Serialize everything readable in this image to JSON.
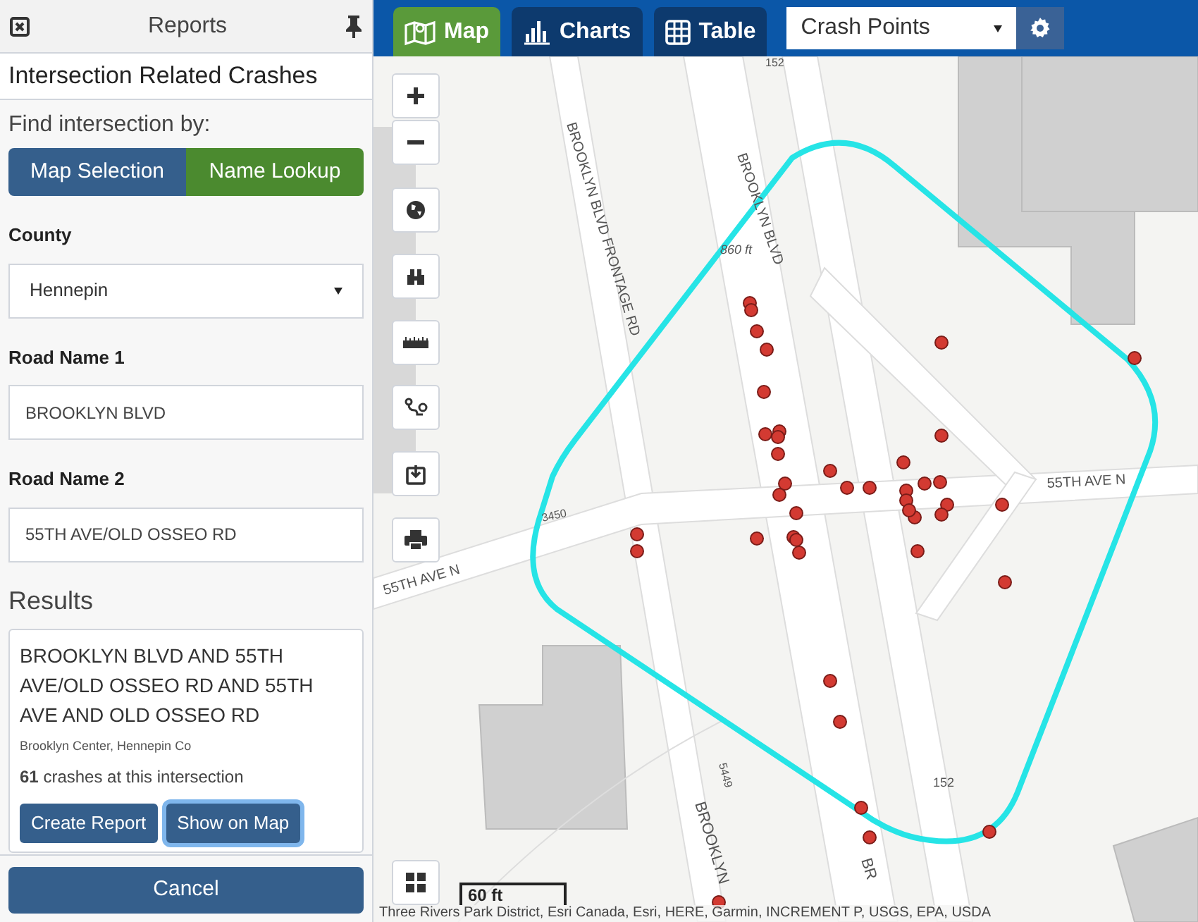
{
  "panel": {
    "title": "Reports",
    "heading": "Intersection Related Crashes",
    "find_label": "Find intersection by:",
    "modes": [
      {
        "label": "Map Selection",
        "selected": false
      },
      {
        "label": "Name Lookup",
        "selected": true
      }
    ],
    "fields": [
      {
        "kind": "select",
        "label": "County",
        "value": "Hennepin"
      },
      {
        "kind": "text",
        "label": "Road Name 1",
        "value": "BROOKLYN BLVD"
      },
      {
        "kind": "text",
        "label": "Road Name 2",
        "value": "55TH AVE/OLD OSSEO RD"
      }
    ],
    "results_title": "Results",
    "result": {
      "name": "BROOKLYN BLVD AND 55TH AVE/OLD OSSEO RD AND 55TH AVE AND OLD OSSEO RD",
      "location": "Brooklyn Center, Hennepin Co",
      "count": "**61** crashes at this intersection",
      "buttons": [
        {
          "label": "Create Report",
          "focused": false
        },
        {
          "label": "Show on Map",
          "focused": true
        }
      ]
    },
    "cancel": "Cancel"
  },
  "toolbar": {
    "tabs": [
      {
        "label": "Map",
        "selected": true
      },
      {
        "label": "Charts",
        "selected": false
      },
      {
        "label": "Table",
        "selected": false
      }
    ],
    "layer": "Crash Points"
  },
  "map": {
    "labels": [
      "BROOKLYN BLVD FRONTAGE RD",
      "860 ft",
      "BROOKLYN BLVD",
      "152",
      "55TH AVE N",
      "3450",
      "55TH AVE N",
      "5449",
      "BROOKLYN",
      "BR",
      "152"
    ],
    "scale": "60 ft",
    "attribution": "Three Rivers Park District, Esri Canada, Esri, HERE, Garmin, INCREMENT P, USGS, EPA, USDA"
  }
}
